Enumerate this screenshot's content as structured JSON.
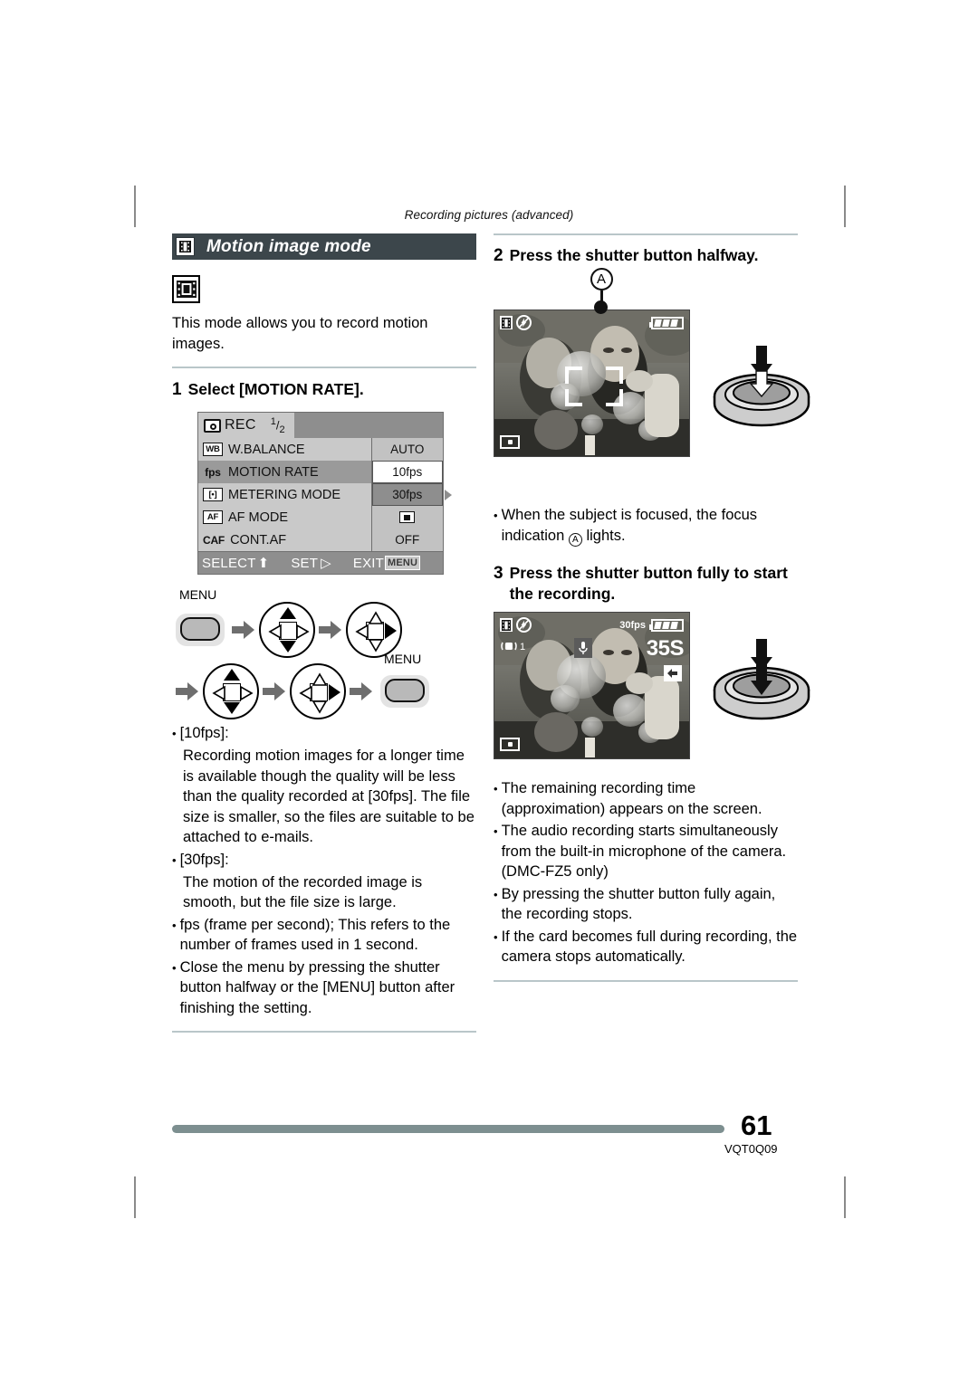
{
  "running_head": "Recording pictures (advanced)",
  "section": {
    "title": "Motion image mode",
    "icon": "film-strip-icon",
    "intro": "This mode allows you to record motion images."
  },
  "steps": {
    "step1": {
      "num": "1",
      "text": "Select [MOTION RATE]."
    },
    "step2": {
      "num": "2",
      "text": "Press the shutter button halfway."
    },
    "step3": {
      "num": "3",
      "text": "Press the shutter button fully to start the recording."
    }
  },
  "camera_menu": {
    "tab_label": "REC",
    "page_num": "1",
    "page_den": "2",
    "rows": [
      {
        "icon": "WB",
        "label": "W.BALANCE",
        "value": "AUTO",
        "selected": false
      },
      {
        "icon": "fps",
        "label": "MOTION RATE",
        "value": "10fps",
        "selected": true
      },
      {
        "icon": "[•]",
        "label": "METERING MODE",
        "value": "30fps",
        "selected": false
      },
      {
        "icon": "AF",
        "label": "AF MODE",
        "value": "",
        "selected": false
      },
      {
        "icon": "CAF",
        "label": "CONT.AF",
        "value": "OFF",
        "selected": false
      }
    ],
    "footer": {
      "select": "SELECT",
      "set": "SET",
      "exit": "EXIT",
      "menu_chip": "MENU"
    }
  },
  "nav_diagram": {
    "menu_label_top": "MENU",
    "menu_label_bottom": "MENU"
  },
  "left_bullets": [
    {
      "lead": "[10fps]:",
      "text": "Recording motion images for a longer time is available though the quality will be less than the quality recorded at [30fps]. The file size is smaller, so the files are suitable to be attached to e-mails."
    },
    {
      "lead": "[30fps]:",
      "text": "The motion of the recorded image is smooth, but the file size is large."
    },
    {
      "lead": "",
      "text": "fps (frame per second);  This refers to the number of frames used in 1 second."
    },
    {
      "lead": "",
      "text": "Close the menu by pressing the shutter button halfway or the [MENU] button after finishing the setting."
    }
  ],
  "photo_halfway": {
    "callout_letter": "A",
    "osd": {
      "film": "film-icon",
      "flash_off": "flash-off-icon",
      "battery": "battery-icon",
      "metering": "metering-icon"
    }
  },
  "photo_recording": {
    "osd": {
      "fps": "30fps",
      "time_remaining": "35S",
      "stabilizer": "1",
      "mic": "microphone-icon"
    }
  },
  "right_bullets_step2": [
    "When the subject is focused, the focus indication Ⓐ lights."
  ],
  "right_bullets_step3": [
    "The remaining recording time (approximation) appears on the screen.",
    "The audio recording starts simultaneously from the built-in microphone of the camera. (DMC-FZ5 only)",
    "By pressing the shutter button fully again, the recording stops.",
    "If the card becomes full during recording, the camera stops automatically."
  ],
  "footer": {
    "page_number": "61",
    "doc_code": "VQT0Q09"
  },
  "colors": {
    "title_bar": "#3c464b",
    "rule": "#b9c6c9",
    "footer_rule": "#7d8f90"
  }
}
